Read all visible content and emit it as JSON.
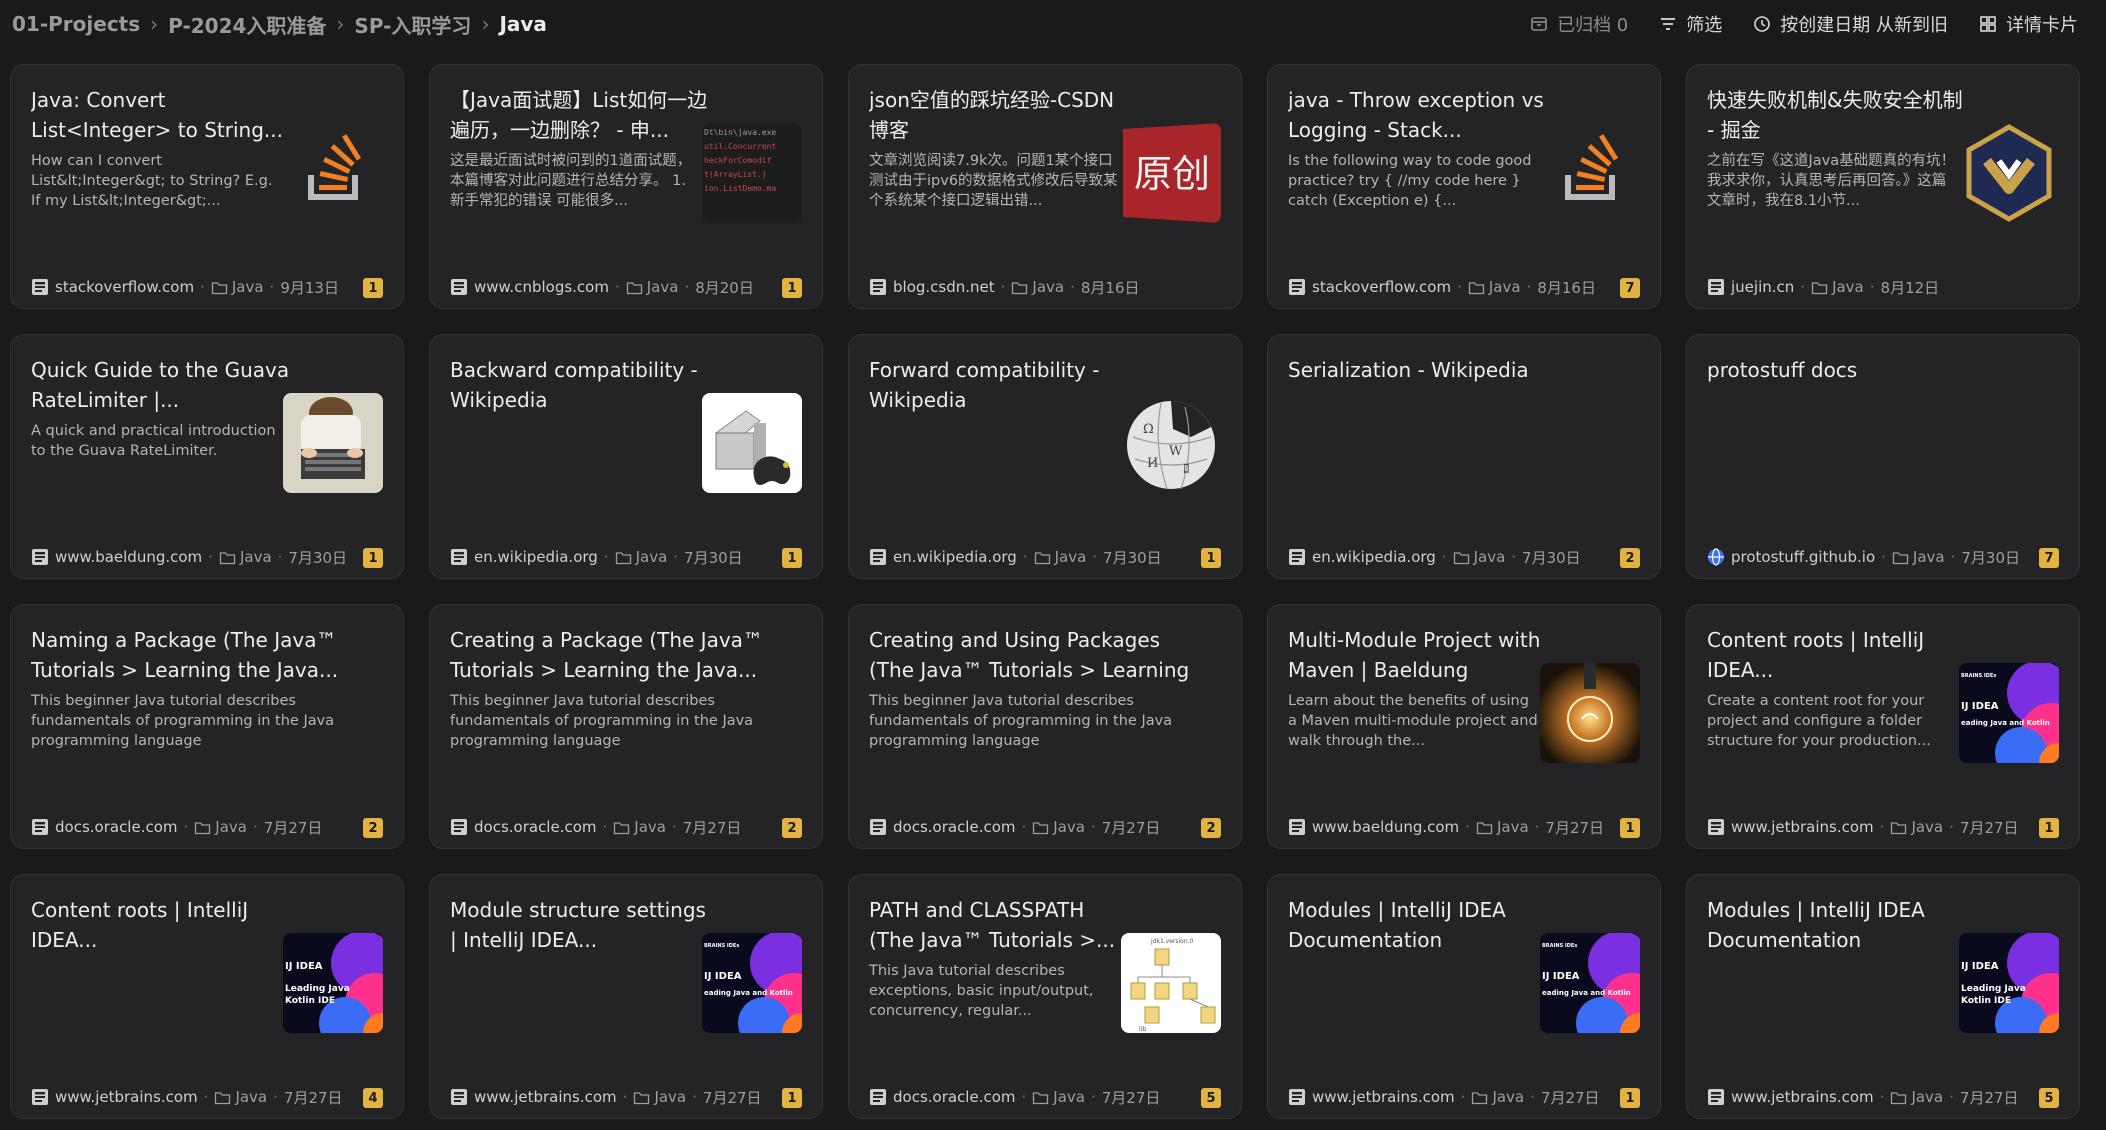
{
  "breadcrumb": [
    "01-Projects",
    "P-2024入职准备",
    "SP-入职学习",
    "Java"
  ],
  "toolbar": {
    "archived": "已归档 0",
    "filter": "筛选",
    "sort": "按创建日期 从新到旧",
    "view": "详情卡片"
  },
  "cards": [
    {
      "title": "Java: Convert List<Integer> to String...",
      "desc": "How can I convert List&lt;Integer&gt; to String? E.g. If my List&lt;Integer&gt;...",
      "thumb": "stackoverflow-icon",
      "site": "stackoverflow.com",
      "folder": "Java",
      "date": "9月13日",
      "count": "1"
    },
    {
      "title": "【Java面试题】List如何一边遍历，一边删除？ - 申...",
      "desc": "这是最近面试时被问到的1道面试题，本篇博客对此问题进行总结分享。 1. 新手常犯的错误 可能很多...",
      "thumb": "code-screenshot",
      "site": "www.cnblogs.com",
      "folder": "Java",
      "date": "8月20日",
      "count": "1"
    },
    {
      "title": "json空值的踩坑经验-CSDN博客",
      "desc": "文章浏览阅读7.9k次。问题1某个接口测试由于ipv6的数据格式修改后导致某个系统某个接口逻辑出错...",
      "thumb": "original-tag",
      "thumb_text": "原创",
      "site": "blog.csdn.net",
      "folder": "Java",
      "date": "8月16日",
      "count": ""
    },
    {
      "title": "java - Throw exception vs Logging - Stack...",
      "desc": "Is the following way to code good practice? try { //my code here } catch (Exception e) {...",
      "thumb": "stackoverflow-icon",
      "site": "stackoverflow.com",
      "folder": "Java",
      "date": "8月16日",
      "count": "7"
    },
    {
      "title": "快速失败机制&失败安全机制 - 掘金",
      "desc": "之前在写《这道Java基础题真的有坑！我求求你，认真思考后再回答。》这篇文章时，我在8.1小节...",
      "thumb": "juejin-logo",
      "site": "juejin.cn",
      "folder": "Java",
      "date": "8月12日",
      "count": ""
    },
    {
      "title": "Quick Guide to the Guava RateLimiter |...",
      "desc": "A quick and practical introduction to the Guava RateLimiter.",
      "thumb": "laptop-photo",
      "site": "www.baeldung.com",
      "folder": "Java",
      "date": "7月30日",
      "count": "1"
    },
    {
      "title": "Backward compatibility - Wikipedia",
      "desc": "",
      "thumb": "console-photo",
      "site": "en.wikipedia.org",
      "folder": "Java",
      "date": "7月30日",
      "count": "1"
    },
    {
      "title": "Forward compatibility - Wikipedia",
      "desc": "",
      "thumb": "wikipedia-globe",
      "site": "en.wikipedia.org",
      "folder": "Java",
      "date": "7月30日",
      "count": "1"
    },
    {
      "title": "Serialization - Wikipedia",
      "desc": "",
      "thumb": "",
      "site": "en.wikipedia.org",
      "folder": "Java",
      "date": "7月30日",
      "count": "2"
    },
    {
      "title": "protostuff docs",
      "desc": "",
      "thumb": "",
      "site": "protostuff.github.io",
      "folder": "Java",
      "date": "7月30日",
      "count": "7"
    },
    {
      "title": "Naming a Package (The Java™ Tutorials > Learning the Java...",
      "desc": "This beginner Java tutorial describes fundamentals of programming in the Java programming language",
      "thumb": "",
      "site": "docs.oracle.com",
      "folder": "Java",
      "date": "7月27日",
      "count": "2"
    },
    {
      "title": "Creating a Package (The Java™ Tutorials > Learning the Java...",
      "desc": "This beginner Java tutorial describes fundamentals of programming in the Java programming language",
      "thumb": "",
      "site": "docs.oracle.com",
      "folder": "Java",
      "date": "7月27日",
      "count": "2"
    },
    {
      "title": "Creating and Using Packages (The Java™ Tutorials > Learning the...",
      "desc": "This beginner Java tutorial describes fundamentals of programming in the Java programming language",
      "thumb": "",
      "site": "docs.oracle.com",
      "folder": "Java",
      "date": "7月27日",
      "count": "2"
    },
    {
      "title": "Multi-Module Project with Maven | Baeldung",
      "desc": "Learn about the benefits of using a Maven multi-module project and walk through the...",
      "thumb": "bulb-photo",
      "site": "www.baeldung.com",
      "folder": "Java",
      "date": "7月27日",
      "count": "1"
    },
    {
      "title": "Content roots | IntelliJ IDEA...",
      "desc": "Create a content root for your project and configure a folder structure for your production...",
      "thumb": "intellij-banner",
      "thumb_lines": [
        "BRAINS IDEs",
        "IJ IDEA",
        "eading Java and Kotlin"
      ],
      "site": "www.jetbrains.com",
      "folder": "Java",
      "date": "7月27日",
      "count": "1"
    },
    {
      "title": "Content roots | IntelliJ IDEA...",
      "desc": "",
      "thumb": "intellij-banner",
      "thumb_lines": [
        "",
        "IJ IDEA",
        "Leading Java",
        "Kotlin IDE"
      ],
      "site": "www.jetbrains.com",
      "folder": "Java",
      "date": "7月27日",
      "count": "4"
    },
    {
      "title": "Module structure settings | IntelliJ IDEA...",
      "desc": "",
      "thumb": "intellij-banner",
      "thumb_lines": [
        "BRAINS IDEs",
        "IJ IDEA",
        "eading Java and Kotlin"
      ],
      "site": "www.jetbrains.com",
      "folder": "Java",
      "date": "7月27日",
      "count": "1"
    },
    {
      "title": "PATH and CLASSPATH (The Java™ Tutorials >...",
      "desc": "This Java tutorial describes exceptions, basic input/output, concurrency, regular...",
      "thumb": "folder-diagram",
      "site": "docs.oracle.com",
      "folder": "Java",
      "date": "7月27日",
      "count": "5"
    },
    {
      "title": "Modules | IntelliJ IDEA Documentation",
      "desc": "",
      "thumb": "intellij-banner",
      "thumb_lines": [
        "BRAINS IDEs",
        "IJ IDEA",
        "eading Java and Kotlin"
      ],
      "site": "www.jetbrains.com",
      "folder": "Java",
      "date": "7月27日",
      "count": "1"
    },
    {
      "title": "Modules | IntelliJ IDEA Documentation",
      "desc": "",
      "thumb": "intellij-banner",
      "thumb_lines": [
        "",
        "IJ IDEA",
        "Leading Java",
        "Kotlin IDE"
      ],
      "site": "www.jetbrains.com",
      "folder": "Java",
      "date": "7月27日",
      "count": "5"
    }
  ]
}
